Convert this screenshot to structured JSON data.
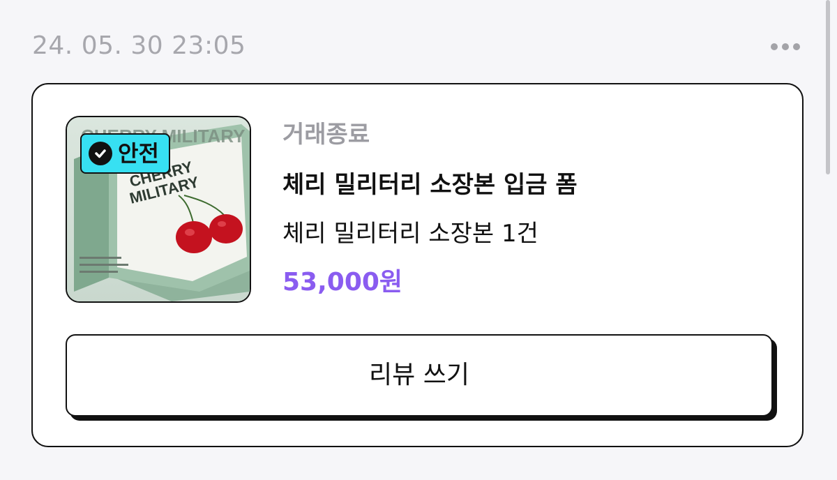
{
  "header": {
    "timestamp": "24. 05. 30 23:05",
    "more_icon": "more-horizontal-icon"
  },
  "order": {
    "safe_badge_label": "안전",
    "safe_badge_icon": "check-circle-icon",
    "status": "거래종료",
    "title": "체리 밀리터리 소장본 입금 폼",
    "option": "체리 밀리터리 소장본 1건",
    "price": "53,000원",
    "thumbnail_cover_text": "CHERRY MILITARY",
    "review_button_label": "리뷰 쓰기"
  },
  "colors": {
    "accent_price": "#8a5cf0",
    "badge_background": "#37e0f2",
    "status_gray": "#9c9ca2"
  }
}
